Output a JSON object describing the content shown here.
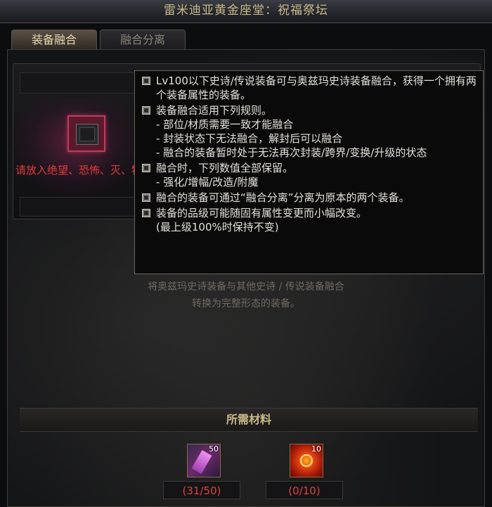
{
  "window": {
    "title": "雷米迪亚黄金座堂：祝福祭坛"
  },
  "tabs": [
    {
      "label": "装备融合",
      "active": true
    },
    {
      "label": "融合分离",
      "active": false
    }
  ],
  "slot": {
    "hint": "请放入绝望、恐怖、灭、牺牲、神焰装备"
  },
  "description": {
    "line1": "将奥兹玛史诗装备与其他史诗 / 传说装备融合",
    "line2": "转换为完整形态的装备。"
  },
  "tooltip": {
    "items": [
      {
        "lines": [
          "Lv100以下史诗/传说装备可与奥兹玛史诗装备融合，获得一个拥有两个装备属性的装备。"
        ]
      },
      {
        "lines": [
          "装备融合适用下列规则。",
          "- 部位/材质需要一致才能融合",
          "- 封装状态下无法融合，解封后可以融合",
          "- 融合的装备暂时处于无法再次封装/跨界/变换/升级的状态"
        ]
      },
      {
        "lines": [
          "融合时，下列数值全部保留。",
          "- 强化/增幅/改造/附魔"
        ]
      },
      {
        "lines": [
          "融合的装备可通过“融合分离”分离为原本的两个装备。"
        ]
      },
      {
        "lines": [
          "装备的品级可能随固有属性变更而小幅改变。",
          "(最上级100%时保持不变)"
        ]
      }
    ]
  },
  "materials": {
    "header": "所需材料",
    "items": [
      {
        "icon": "crystal-icon",
        "count_badge": "50",
        "quantity": "(31/50)",
        "accent": "#c050c0"
      },
      {
        "icon": "sun-emblem-icon",
        "count_badge": "10",
        "quantity": "(0/10)",
        "accent": "#e04010"
      }
    ]
  }
}
